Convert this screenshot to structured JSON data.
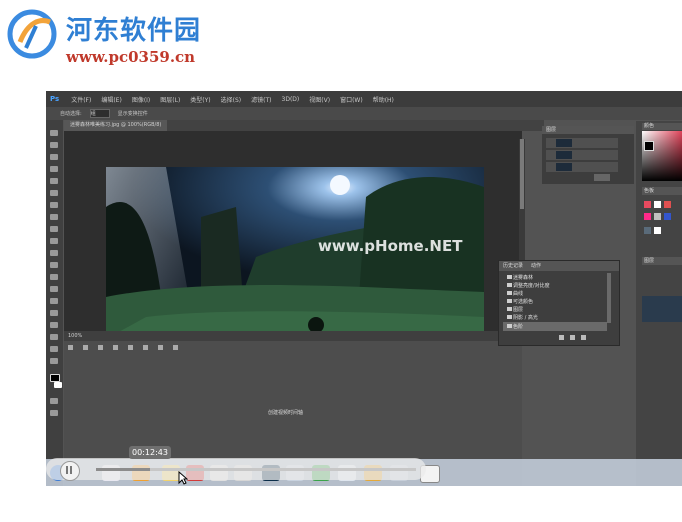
{
  "watermark": {
    "title": "河东软件园",
    "url": "www.pc0359.cn",
    "overlay": "www.pHome.NET"
  },
  "photoshop": {
    "logo": "Ps",
    "menu": [
      "文件(F)",
      "编辑(E)",
      "图像(I)",
      "图层(L)",
      "类型(Y)",
      "选择(S)",
      "滤镜(T)",
      "3D(D)",
      "视图(V)",
      "窗口(W)",
      "帮助(H)"
    ],
    "options": {
      "auto_select_label": "自动选择:",
      "auto_select_value": "组",
      "show_transform": "显示变换控件"
    },
    "doc_tab": "迷雾森林唯美练习.jpg @ 100%(RGB/8)",
    "status_zoom": "100%",
    "timeline_button": "创建视频时间轴",
    "history": {
      "tabs": [
        "历史记录",
        "动作"
      ],
      "items": [
        "迷雾森林",
        "调整亮度/对比度",
        "曲线",
        "可选颜色",
        "图层",
        "阴影 / 高光",
        "色阶"
      ],
      "selected_index": 6
    },
    "panels": {
      "layers_title": "图层",
      "color_title": "颜色",
      "swatches_title": "色板",
      "side_title": "图层"
    }
  },
  "player": {
    "current_time": "00:12:43",
    "progress": 0.17
  },
  "colors": {
    "watermark_blue": "#2f7fd3",
    "watermark_red": "#c0392b",
    "ps_dark": "#535353"
  }
}
